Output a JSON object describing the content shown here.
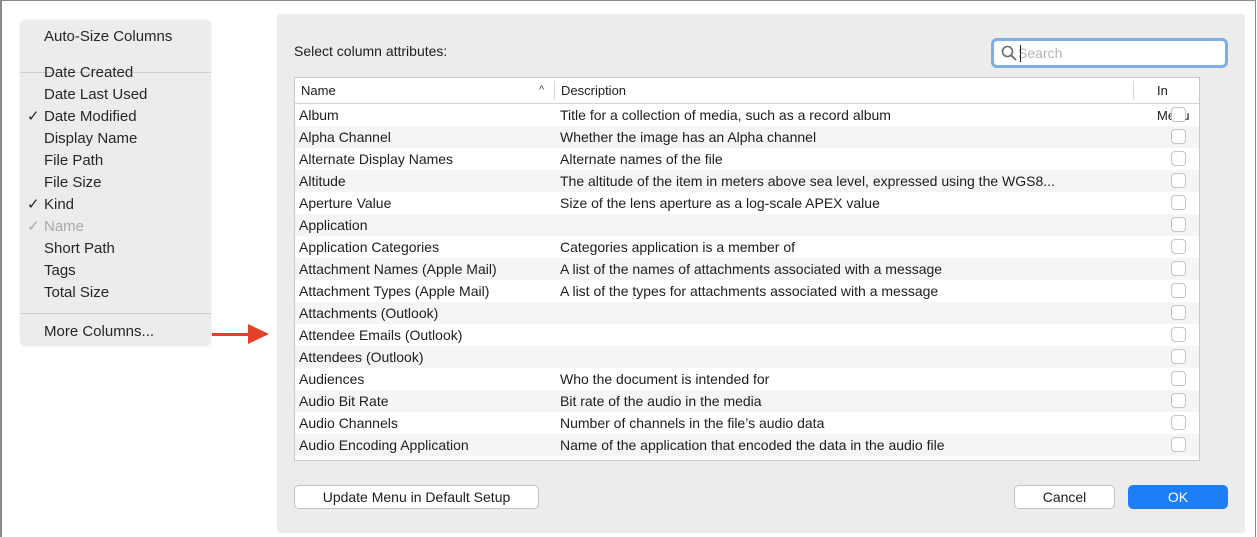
{
  "menu": {
    "items": [
      {
        "label": "Auto-Size Columns",
        "checked": false,
        "disabled": false
      },
      {
        "label": "Date Created",
        "checked": false,
        "disabled": false
      },
      {
        "label": "Date Last Used",
        "checked": false,
        "disabled": false
      },
      {
        "label": "Date Modified",
        "checked": true,
        "disabled": false
      },
      {
        "label": "Display Name",
        "checked": false,
        "disabled": false
      },
      {
        "label": "File Path",
        "checked": false,
        "disabled": false
      },
      {
        "label": "File Size",
        "checked": false,
        "disabled": false
      },
      {
        "label": "Kind",
        "checked": true,
        "disabled": false
      },
      {
        "label": "Name",
        "checked": true,
        "disabled": true
      },
      {
        "label": "Short Path",
        "checked": false,
        "disabled": false
      },
      {
        "label": "Tags",
        "checked": false,
        "disabled": false
      },
      {
        "label": "Total Size",
        "checked": false,
        "disabled": false
      },
      {
        "label": "More Columns...",
        "checked": false,
        "disabled": false
      }
    ],
    "check_glyph": "✓"
  },
  "annotation": {
    "arrow_color": "#e6402d"
  },
  "dialog": {
    "title": "Select column attributes:",
    "search": {
      "placeholder": "Search",
      "value": "",
      "icon": "magnifier-icon"
    },
    "table": {
      "columns": {
        "name": "Name",
        "description": "Description",
        "in_menu": "In Menu"
      },
      "sort_indicator": "^",
      "rows": [
        {
          "name": "Album",
          "description": "Title for a collection of media, such as a record album",
          "in_menu": false
        },
        {
          "name": "Alpha Channel",
          "description": "Whether the image has an Alpha channel",
          "in_menu": false
        },
        {
          "name": "Alternate Display Names",
          "description": "Alternate names of the file",
          "in_menu": false
        },
        {
          "name": "Altitude",
          "description": "The altitude of the item in meters above sea level, expressed using the WGS8...",
          "in_menu": false
        },
        {
          "name": "Aperture Value",
          "description": "Size of the lens aperture as a log-scale APEX value",
          "in_menu": false
        },
        {
          "name": "Application",
          "description": "",
          "in_menu": false
        },
        {
          "name": "Application Categories",
          "description": "Categories application is a member of",
          "in_menu": false
        },
        {
          "name": "Attachment Names (Apple Mail)",
          "description": "A list of the names of attachments associated with a message",
          "in_menu": false
        },
        {
          "name": "Attachment Types (Apple Mail)",
          "description": "A list of the types for attachments associated with a message",
          "in_menu": false
        },
        {
          "name": "Attachments (Outlook)",
          "description": "",
          "in_menu": false
        },
        {
          "name": "Attendee Emails (Outlook)",
          "description": "",
          "in_menu": false
        },
        {
          "name": "Attendees (Outlook)",
          "description": "",
          "in_menu": false
        },
        {
          "name": "Audiences",
          "description": "Who the document is intended for",
          "in_menu": false
        },
        {
          "name": "Audio Bit Rate",
          "description": "Bit rate of the audio in the media",
          "in_menu": false
        },
        {
          "name": "Audio Channels",
          "description": "Number of channels in the file’s audio data",
          "in_menu": false
        },
        {
          "name": "Audio Encoding Application",
          "description": "Name of the application that encoded the data in the audio file",
          "in_menu": false
        }
      ]
    },
    "buttons": {
      "update_default": "Update Menu in Default Setup",
      "cancel": "Cancel",
      "ok": "OK"
    },
    "colors": {
      "accent": "#1e7ef6",
      "focus_ring": "#7faee5"
    }
  }
}
